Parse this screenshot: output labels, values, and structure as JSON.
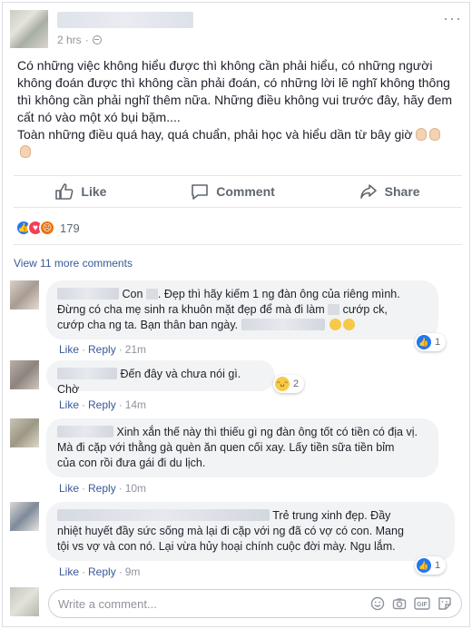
{
  "post": {
    "timestamp": "2 hrs",
    "more": "···",
    "lines": [
      "Có những việc không hiểu được thì không cần phải hiểu, có những người",
      "không đoán được thì không cần phải đoán, có những lời lẽ nghĩ không thông",
      "thì không cần phải nghĩ thêm nữa. Những điều không vui trước đây, hãy đem",
      "cất nó vào một xó bụi bặm....",
      "Toàn những điều quá hay, quá chuẩn, phải học và hiểu dần từ bây giờ"
    ]
  },
  "actions": {
    "like": "Like",
    "comment": "Comment",
    "share": "Share"
  },
  "reactions": {
    "count": "179",
    "like_color": "#2078f4",
    "love_color": "#f33e58",
    "angry_color": "#e9710f"
  },
  "view_more": "View 11 more comments",
  "comments": [
    {
      "segments": [
        "Con",
        ". Đẹp thì hãy kiếm 1 ng đàn ông của riêng mình.",
        "Đừng có cha mẹ sinh ra khuôn mặt đẹp để mà đi làm",
        "cướp ck,",
        "cướp cha ng ta. Bạn thân ban ngày."
      ],
      "like": "Like",
      "reply": "Reply",
      "time": "21m",
      "reaction_count": "1"
    },
    {
      "text": "Đến đây và chưa nói gì. Chờ",
      "like": "Like",
      "reply": "Reply",
      "time": "14m",
      "reaction_count": "2"
    },
    {
      "lines": [
        "Xinh xắn thế này thì thiếu gì ng đàn ông tốt có tiền có địa vị.",
        "Mà đi cặp với thằng gà quèn ăn quen cối xay. Lấy tiền sữa tiền bỉm",
        "của con rồi đưa gái đi du lịch."
      ],
      "like": "Like",
      "reply": "Reply",
      "time": "10m"
    },
    {
      "lines": [
        "Trẻ trung xinh đẹp. Đầy",
        "nhiệt huyết đầy sức sống mà lại đi cặp với ng đã có vợ có con. Mang",
        "tội vs vợ và con nó. Lại vừa hủy hoại chính cuộc đời mày. Ngu lắm."
      ],
      "like": "Like",
      "reply": "Reply",
      "time": "9m",
      "reaction_count": "1"
    }
  ],
  "write_comment": {
    "placeholder": "Write a comment..."
  }
}
